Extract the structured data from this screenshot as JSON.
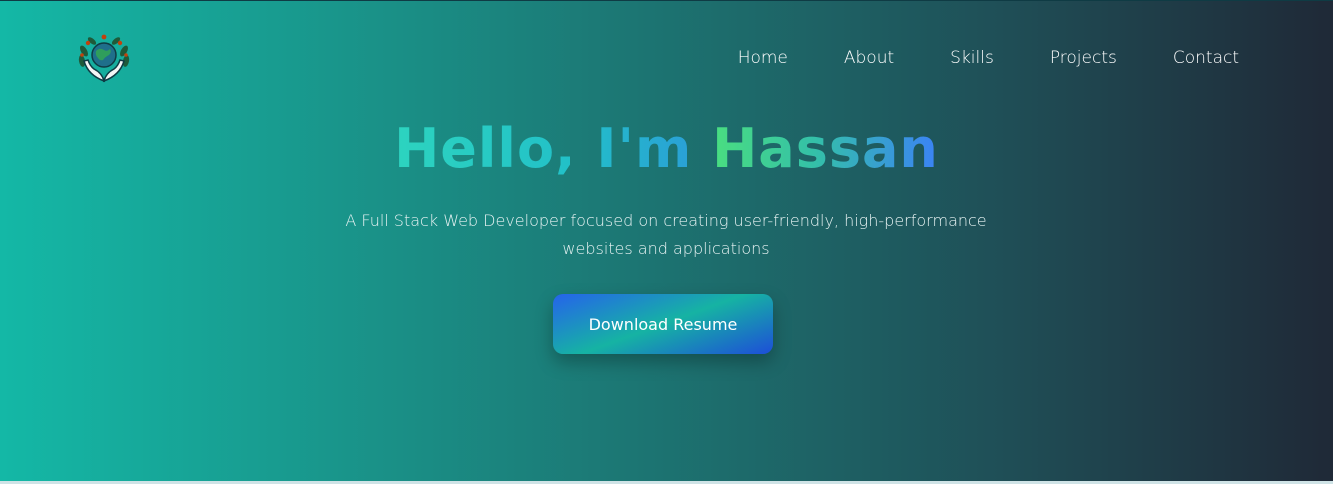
{
  "nav": {
    "items": [
      {
        "label": "Home"
      },
      {
        "label": "About"
      },
      {
        "label": "Skills"
      },
      {
        "label": "Projects"
      },
      {
        "label": "Contact"
      }
    ]
  },
  "logo": {
    "icon": "globe-in-hands-icon"
  },
  "hero": {
    "greeting": "Hello, I'm",
    "name": "Hassan",
    "subtitle_line1": "A Full Stack Web Developer focused on creating user-friendly, high-performance",
    "subtitle_line2": "websites and applications",
    "cta_label": "Download Resume"
  },
  "colors": {
    "bg_start": "#14b8a6",
    "bg_end": "#1f2937",
    "accent_green": "#4ade80",
    "accent_blue": "#3b82f6"
  }
}
